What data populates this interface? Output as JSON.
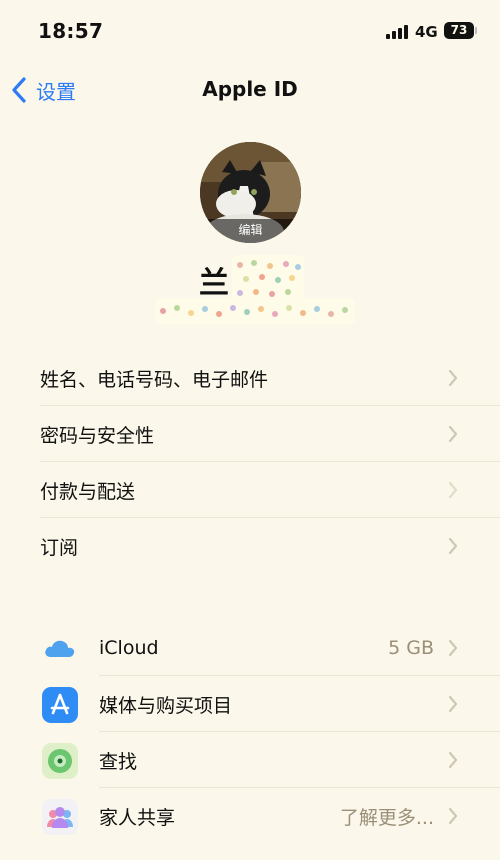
{
  "status_bar": {
    "time": "18:57",
    "network": "4G",
    "battery": "73"
  },
  "nav": {
    "back_label": "设置",
    "title": "Apple ID"
  },
  "profile": {
    "edit_label": "编辑",
    "name_visible": "兰"
  },
  "account_items": [
    {
      "label": "姓名、电话号码、电子邮件"
    },
    {
      "label": "密码与安全性"
    },
    {
      "label": "付款与配送"
    },
    {
      "label": "订阅"
    }
  ],
  "services": [
    {
      "label": "iCloud",
      "value": "5 GB",
      "icon": "icloud-icon"
    },
    {
      "label": "媒体与购买项目",
      "value": "",
      "icon": "app-store-icon"
    },
    {
      "label": "查找",
      "value": "",
      "icon": "find-my-icon"
    },
    {
      "label": "家人共享",
      "value": "了解更多...",
      "icon": "family-sharing-icon"
    }
  ],
  "colors": {
    "accent": "#2d7cf6",
    "background": "#fbf7ea",
    "secondary_text": "#9b8f78"
  }
}
